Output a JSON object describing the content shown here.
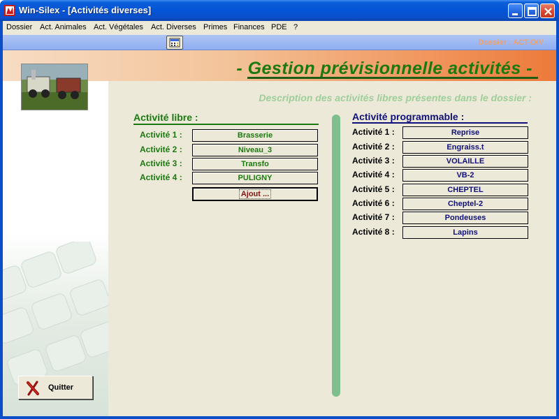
{
  "window": {
    "title": "Win-Silex - [Activités diverses]",
    "accent_color": "#0a4fc8"
  },
  "menu": {
    "items": [
      "Dossier",
      "Act. Animales",
      "Act. Végétales",
      "Act. Diverses",
      "Primes",
      "Finances",
      "PDE",
      "?"
    ]
  },
  "toolbar": {
    "button_icon": "calculator-icon",
    "dossier_label": "Dossier : ACT-DIV"
  },
  "header": {
    "title": "- Gestion prévisionnelle activités -"
  },
  "main": {
    "subtitle": "Description des activités libres présentes dans  le dossier :",
    "libre": {
      "title": "Activité libre :",
      "rows": [
        {
          "label": "Activité 1 :",
          "value": "Brasserie"
        },
        {
          "label": "Activité 2 :",
          "value": "Niveau_3"
        },
        {
          "label": "Activité 3 :",
          "value": "Transfo"
        },
        {
          "label": "Activité 4 :",
          "value": "PULIGNY"
        }
      ],
      "add_button": "Ajout ..."
    },
    "prog": {
      "title": "Activité programmable :",
      "rows": [
        {
          "label": "Activité 1 :",
          "value": "Reprise"
        },
        {
          "label": "Activité 2 :",
          "value": "Engraiss.t"
        },
        {
          "label": "Activité 3 :",
          "value": "VOLAILLE"
        },
        {
          "label": "Activité 4 :",
          "value": "VB-2"
        },
        {
          "label": "Activité 5 :",
          "value": "CHEPTEL"
        },
        {
          "label": "Activité 6 :",
          "value": "Cheptel-2"
        },
        {
          "label": "Activité 7 :",
          "value": "Pondeuses"
        },
        {
          "label": "Activité 8 :",
          "value": "Lapins"
        }
      ]
    }
  },
  "sidebar": {
    "quit_label": "Quitter"
  }
}
